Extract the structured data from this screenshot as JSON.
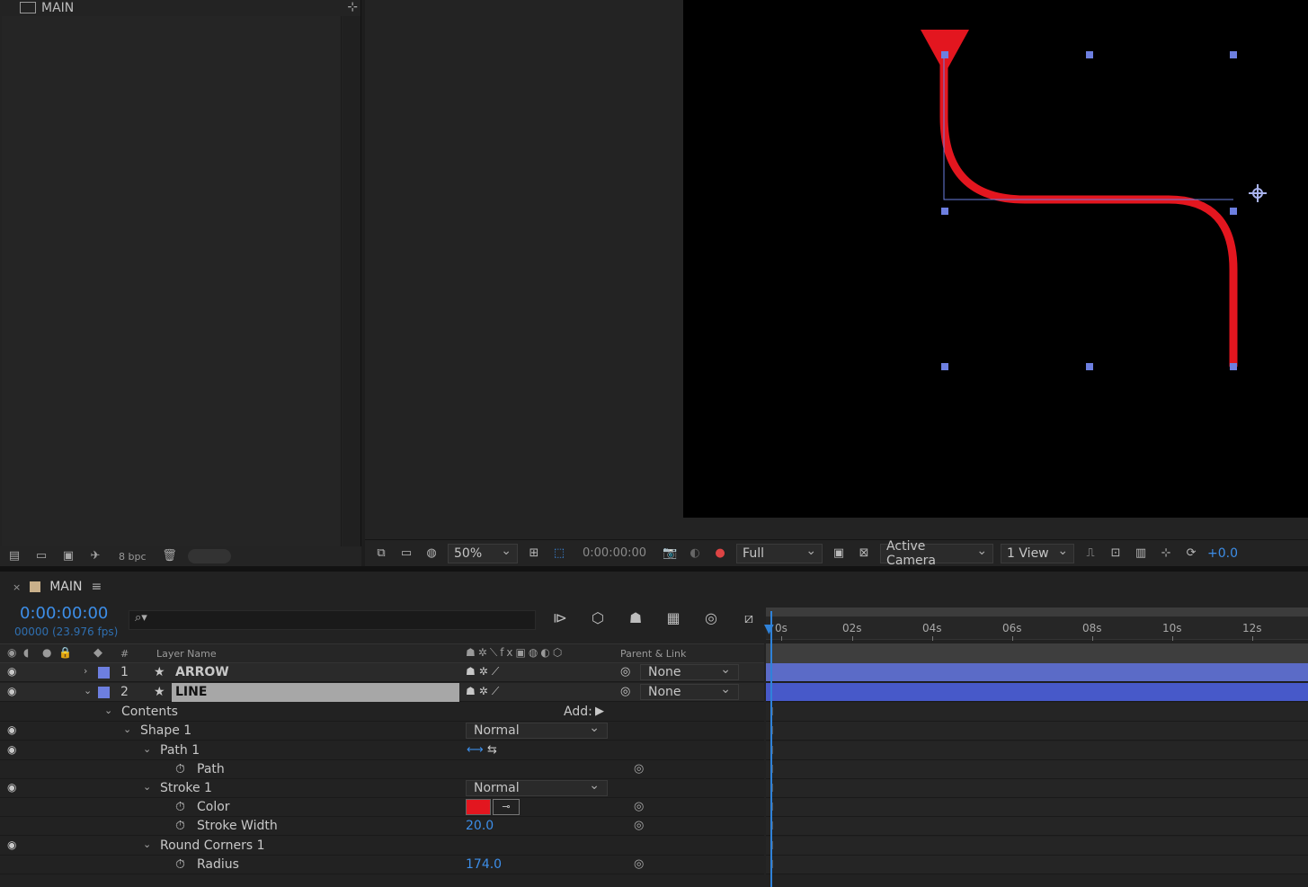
{
  "project": {
    "tab_title": "MAIN",
    "bpc": "8 bpc"
  },
  "viewer": {
    "zoom": "50%",
    "time": "0:00:00:00",
    "resolution": "Full",
    "camera": "Active Camera",
    "views": "1 View",
    "exposure": "+0.0",
    "shape_color": "#e3161f",
    "handle_color": "#6d7fe0"
  },
  "timeline": {
    "tab_close": "×",
    "comp_name": "MAIN",
    "current_time": "0:00:00:00",
    "fps": "00000 (23.976 fps)",
    "search_placeholder": "⌕▾",
    "columns": {
      "hash": "#",
      "layer_name": "Layer Name",
      "parent_link": "Parent & Link"
    },
    "ruler_ticks": [
      "0s",
      "02s",
      "04s",
      "06s",
      "08s",
      "10s",
      "12s"
    ],
    "layers": [
      {
        "num": "1",
        "name": "ARROW",
        "parent": "None"
      },
      {
        "num": "2",
        "name": "LINE",
        "parent": "None"
      }
    ],
    "properties": {
      "contents": "Contents",
      "add_label": "Add:",
      "shape1": "Shape 1",
      "shape1_mode": "Normal",
      "path1": "Path 1",
      "path": "Path",
      "stroke1": "Stroke 1",
      "stroke1_mode": "Normal",
      "color": "Color",
      "stroke_width": "Stroke Width",
      "stroke_width_value": "20.0",
      "round_corners": "Round Corners 1",
      "radius": "Radius",
      "radius_value": "174.0",
      "stroke_color": "#e3161f"
    }
  }
}
